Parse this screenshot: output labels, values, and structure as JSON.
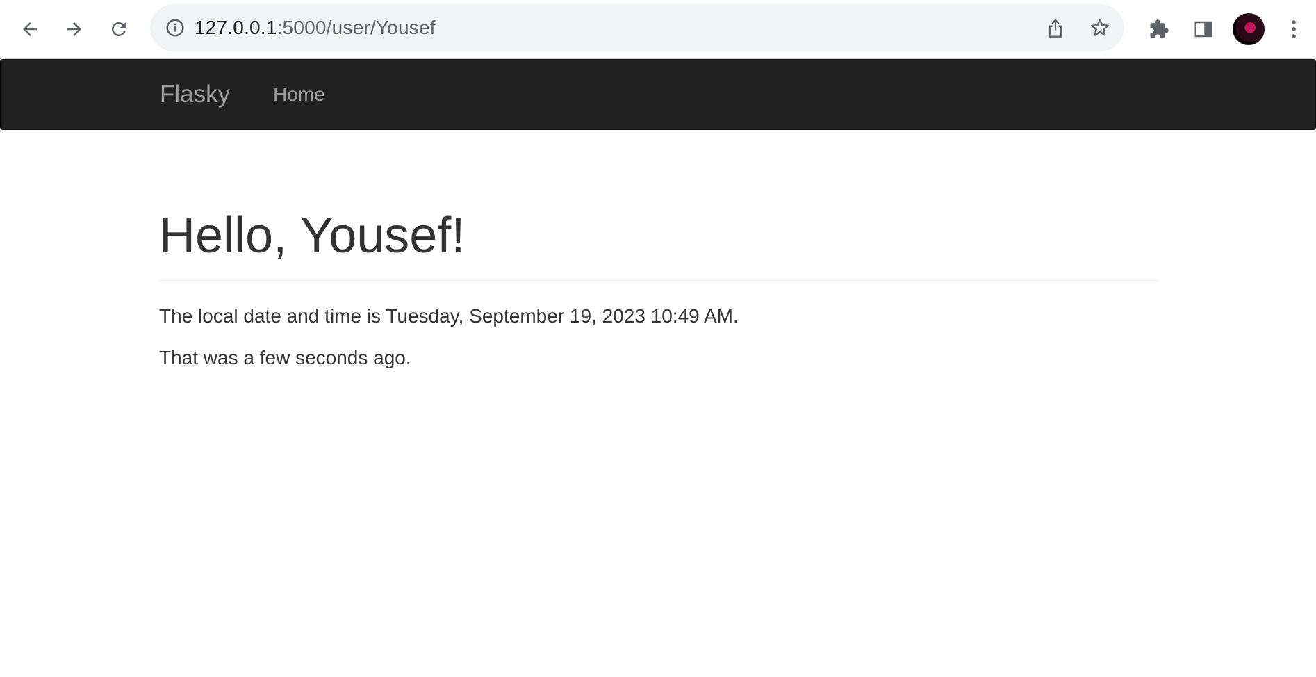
{
  "browser": {
    "url_host": "127.0.0.1",
    "url_path": ":5000/user/Yousef"
  },
  "navbar": {
    "brand": "Flasky",
    "links": [
      {
        "label": "Home"
      }
    ]
  },
  "main": {
    "heading": "Hello, Yousef!",
    "local_datetime_text": "The local date and time is Tuesday, September 19, 2023 10:49 AM.",
    "relative_time_text": "That was a few seconds ago."
  }
}
